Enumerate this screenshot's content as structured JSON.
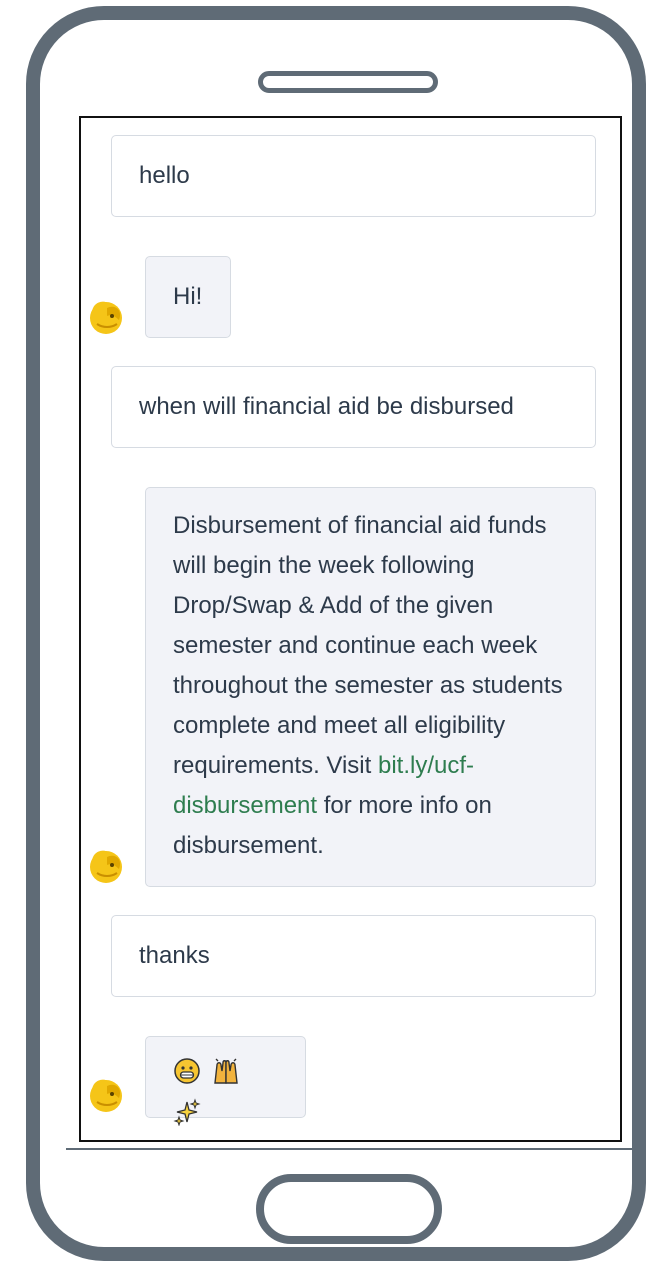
{
  "messages": [
    {
      "role": "user",
      "text": "hello"
    },
    {
      "role": "bot",
      "text": "Hi!"
    },
    {
      "role": "user",
      "text": "when will financial aid be disbursed"
    },
    {
      "role": "bot",
      "text_before": "Disbursement of financial aid funds will begin the week following Drop/Swap & Add of the given semester and continue each week throughout the semester as students complete and meet all eligibility requirements. Visit ",
      "link_text": "bit.ly/ucf-disbursement",
      "text_after": " for more info on disbursement."
    },
    {
      "role": "user",
      "text": "thanks"
    },
    {
      "role": "bot",
      "emojis": [
        "grinning-face",
        "raising-hands",
        "sparkles"
      ]
    }
  ],
  "colors": {
    "frame": "#5f6b76",
    "bot_bubble": "#f2f3f8",
    "user_bubble": "#ffffff",
    "link": "#2e7d4f",
    "avatar": "#f5c518"
  },
  "avatar_icon": "ucf-pegasus-icon"
}
